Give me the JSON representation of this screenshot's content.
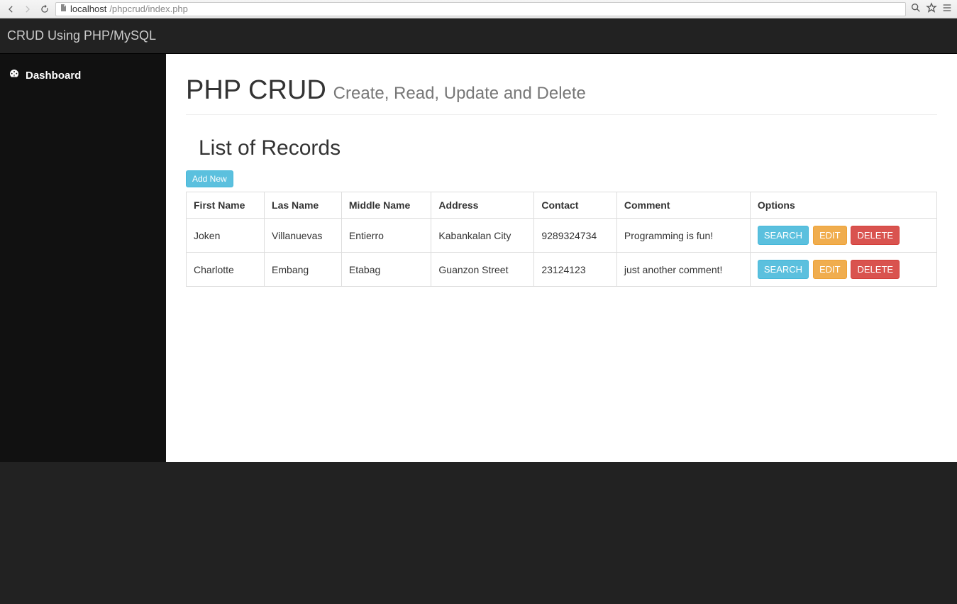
{
  "browser": {
    "url_host": "localhost",
    "url_path": "/phpcrud/index.php"
  },
  "topbar": {
    "title": "CRUD Using PHP/MySQL"
  },
  "sidebar": {
    "items": [
      {
        "label": "Dashboard"
      }
    ]
  },
  "main": {
    "title": "PHP CRUD",
    "subtitle": "Create, Read, Update and Delete",
    "section_title": "List of Records",
    "add_label": "Add New",
    "columns": [
      "First Name",
      "Las Name",
      "Middle Name",
      "Address",
      "Contact",
      "Comment",
      "Options"
    ],
    "rows": [
      {
        "first": "Joken",
        "last": "Villanuevas",
        "middle": "Entierro",
        "address": "Kabankalan City",
        "contact": "9289324734",
        "comment": "Programming is fun!"
      },
      {
        "first": "Charlotte",
        "last": "Embang",
        "middle": "Etabag",
        "address": "Guanzon Street",
        "contact": "23124123",
        "comment": "just another comment!"
      }
    ],
    "actions": {
      "search": "SEARCH",
      "edit": "EDIT",
      "delete": "DELETE"
    }
  }
}
